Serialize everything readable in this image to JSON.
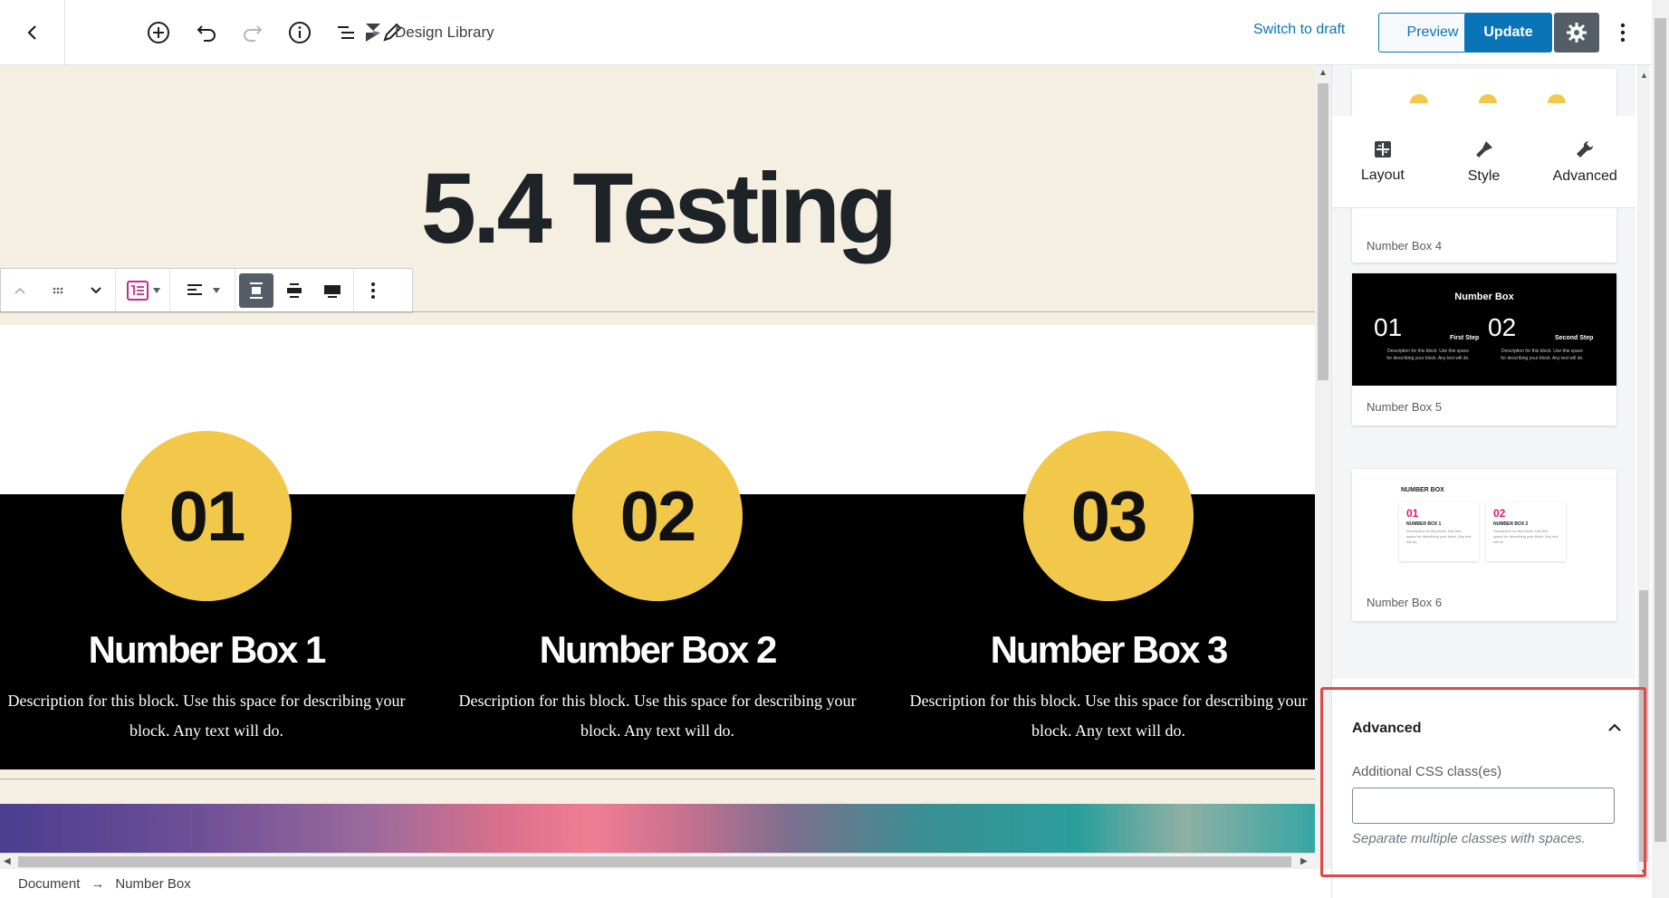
{
  "toolbar": {
    "design_library_label": "Design Library",
    "switch_to_draft": "Switch to draft",
    "preview": "Preview",
    "update": "Update"
  },
  "canvas": {
    "heading": "5.4 Testing",
    "columns": [
      {
        "number": "01",
        "title": "Number Box 1",
        "description": "Description for this block. Use this space for describing your block. Any text will do."
      },
      {
        "number": "02",
        "title": "Number Box 2",
        "description": "Description for this block. Use this space for describing your block. Any text will do."
      },
      {
        "number": "03",
        "title": "Number Box 3",
        "description": "Description for this block. Use this space for describing your block. Any text will do."
      }
    ]
  },
  "breadcrumb": {
    "items": [
      "Document",
      "Number Box"
    ],
    "separator": "→"
  },
  "sidebar": {
    "tabs": [
      {
        "label": "Layout",
        "icon": "layout-icon"
      },
      {
        "label": "Style",
        "icon": "brush-icon"
      },
      {
        "label": "Advanced",
        "icon": "wrench-icon"
      }
    ],
    "designs": [
      {
        "label": "Number Box 4"
      },
      {
        "label": "Number Box 5",
        "preview": {
          "heading": "Number Box",
          "n1": "01",
          "n2": "02",
          "step1": "First Step",
          "step2": "Second Step",
          "desc": "Description for this block. Use this space for describing your block. Any text will do."
        }
      },
      {
        "label": "Number Box 6",
        "preview": {
          "heading": "NUMBER BOX",
          "n1": "01",
          "n2": "02",
          "t1": "NUMBER BOX 1",
          "t2": "NUMBER BOX 2",
          "desc": "Description for this block. Use this space for describing your block. Any text will do."
        }
      }
    ],
    "advanced": {
      "title": "Advanced",
      "css_label": "Additional CSS class(es)",
      "css_value": "",
      "css_help": "Separate multiple classes with spaces."
    }
  },
  "colors": {
    "accent": "#0a75b6",
    "yellow": "#f2c84b",
    "cream": "#f4efe1",
    "highlight": "#e34848"
  }
}
